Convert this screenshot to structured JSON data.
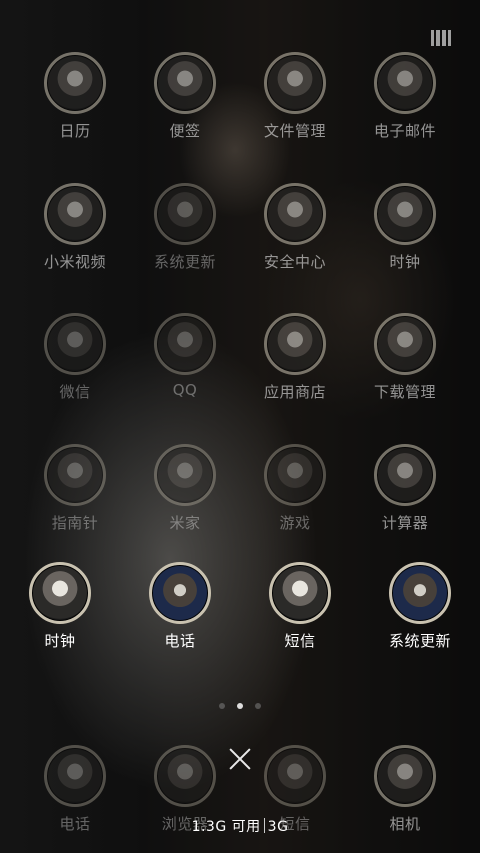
{
  "grid_rows": [
    [
      "日历",
      "便签",
      "文件管理",
      "电子邮件"
    ],
    [
      "小米视频",
      "系统更新",
      "安全中心",
      "时钟"
    ],
    [
      "微信",
      "QQ",
      "应用商店",
      "下载管理"
    ],
    [
      "指南针",
      "米家",
      "游戏",
      "计算器"
    ]
  ],
  "recent_apps": [
    "时钟",
    "电话",
    "短信",
    "系统更新"
  ],
  "dock_apps": [
    "电话",
    "浏览器",
    "短信",
    "相机"
  ],
  "memory": {
    "available": "1.3G 可用",
    "total": "3G"
  },
  "page_indicator": {
    "pages": 3,
    "current": 2
  }
}
